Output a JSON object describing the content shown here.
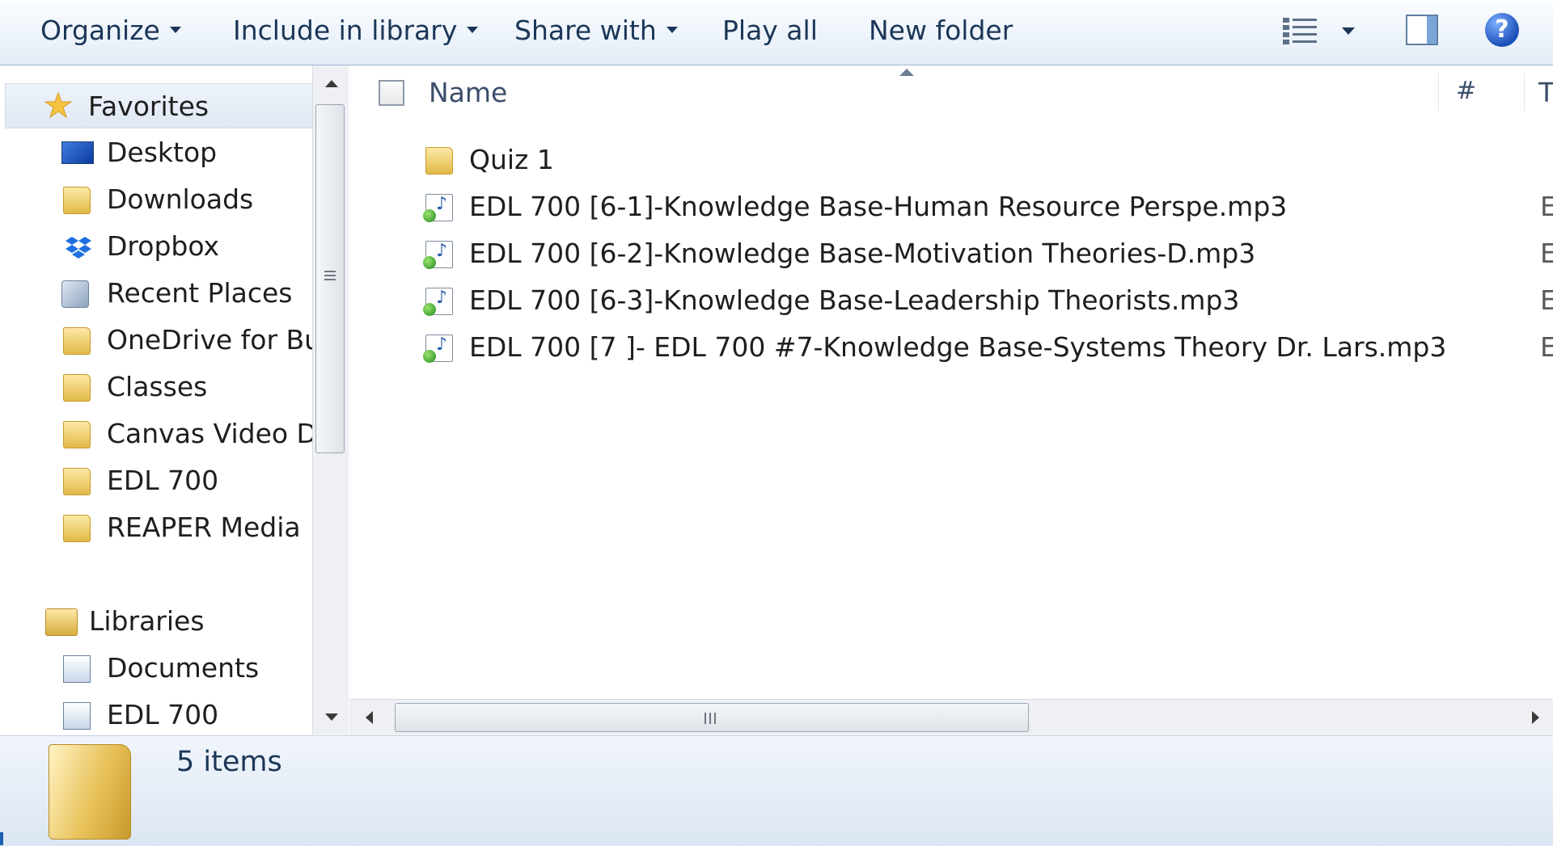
{
  "toolbar": {
    "organize": "Organize",
    "include_in_library": "Include in library",
    "share_with": "Share with",
    "play_all": "Play all",
    "new_folder": "New folder",
    "help": "?"
  },
  "nav": {
    "favorites": {
      "header": "Favorites",
      "items": [
        "Desktop",
        "Downloads",
        "Dropbox",
        "Recent Places",
        "OneDrive for Busi",
        "Classes",
        "Canvas Video Der",
        "EDL 700",
        "REAPER Media"
      ]
    },
    "libraries": {
      "header": "Libraries",
      "items": [
        "Documents",
        "EDL 700"
      ]
    }
  },
  "columns": {
    "name": "Name",
    "number": "#",
    "truncated": "T"
  },
  "files": [
    {
      "name": "Quiz 1",
      "type": "folder",
      "col_t": ""
    },
    {
      "name": "EDL 700 [6-1]-Knowledge Base-Human Resource Perspe.mp3",
      "type": "mp3",
      "col_t": "E"
    },
    {
      "name": "EDL 700 [6-2]-Knowledge Base-Motivation Theories-D.mp3",
      "type": "mp3",
      "col_t": "E"
    },
    {
      "name": "EDL 700 [6-3]-Knowledge Base-Leadership Theorists.mp3",
      "type": "mp3",
      "col_t": "E"
    },
    {
      "name": "EDL 700 [7  ]- EDL 700 #7-Knowledge Base-Systems Theory Dr. Lars.mp3",
      "type": "mp3",
      "col_t": "E"
    }
  ],
  "details": {
    "item_count": "5 items"
  },
  "colors": {
    "toolbar_text": "#1b3657",
    "selection": "#dfe8f3",
    "folder": "#e8c25a"
  }
}
